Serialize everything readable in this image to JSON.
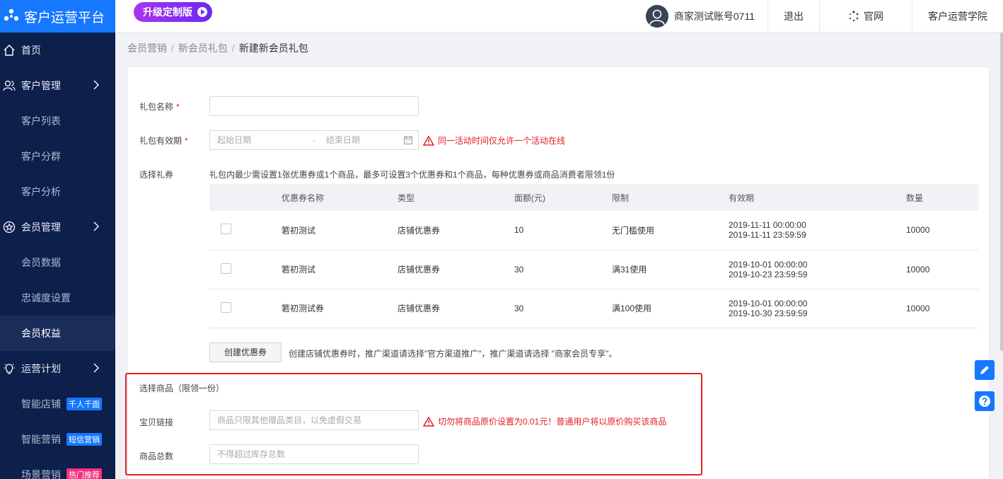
{
  "app": {
    "title": "客户运营平台",
    "upgrade_label": "升级定制版"
  },
  "header": {
    "account": "商家测试账号0711",
    "logout": "退出",
    "official_site": "官网",
    "academy": "客户运营学院"
  },
  "sidebar": {
    "items": [
      {
        "label": "首页",
        "icon": "home-icon"
      },
      {
        "label": "客户管理",
        "icon": "users-icon"
      },
      {
        "label": "客户列表"
      },
      {
        "label": "客户分群"
      },
      {
        "label": "客户分析"
      },
      {
        "label": "会员管理",
        "icon": "star-icon"
      },
      {
        "label": "会员数据"
      },
      {
        "label": "忠诚度设置"
      },
      {
        "label": "会员权益"
      },
      {
        "label": "运营计划",
        "icon": "lightbulb-icon"
      },
      {
        "label": "智能店铺",
        "tag": "千人千面"
      },
      {
        "label": "智能营销",
        "tag": "短信营销"
      },
      {
        "label": "场景营销",
        "tag": "热门推荐"
      }
    ]
  },
  "breadcrumb": [
    "会员营销",
    "新会员礼包",
    "新建新会员礼包"
  ],
  "form": {
    "gift_name_label": "礼包名称",
    "gift_name_required": "*",
    "validity_label": "礼包有效期",
    "validity_required": "*",
    "start_placeholder": "起始日期",
    "date_sep": "-",
    "end_placeholder": "结束日期",
    "validity_warning": "同一活动时间仅允许一个活动在线",
    "coupon_label": "选择礼券",
    "coupon_hint": "礼包内最少需设置1张优惠券或1个商品，最多可设置3个优惠券和1个商品，每种优惠券或商品消费者限领1份",
    "create_coupon_button": "创建优惠券",
    "create_coupon_hint": "创建店铺优惠券时，推广渠道请选择\"官方渠道推广\"，推广渠道请选择 \"商家会员专享\"。",
    "goods_section_label": "选择商品（限领一份）",
    "item_link_label": "宝贝链接",
    "item_link_placeholder": "商品只限其他赠品类目，以免虚假交易",
    "item_link_warning": "切勿将商品原价设置为0.01元！普通用户将以原价购买该商品",
    "goods_total_label": "商品总数",
    "goods_total_placeholder": "不得超过库存总数"
  },
  "coupon_table": {
    "headers": [
      "优惠券名称",
      "类型",
      "面额(元)",
      "限制",
      "有效期",
      "数量"
    ],
    "rows": [
      {
        "name": "箬初测试",
        "type": "店铺优惠券",
        "amount": "10",
        "limit": "无门槛使用",
        "start": "2019-11-11 00:00:00",
        "end": "2019-11-11 23:59:59",
        "qty": "10000"
      },
      {
        "name": "箬初测试",
        "type": "店铺优惠券",
        "amount": "30",
        "limit": "满31使用",
        "start": "2019-10-01 00:00:00",
        "end": "2019-10-23 23:59:59",
        "qty": "10000"
      },
      {
        "name": "箬初测试券",
        "type": "店铺优惠券",
        "amount": "30",
        "limit": "满100使用",
        "start": "2019-10-01 00:00:00",
        "end": "2019-10-30 23:59:59",
        "qty": "10000"
      }
    ]
  },
  "colors": {
    "sidebar_bg": "#0d1f4b",
    "brand_blue": "#1677ff",
    "warning_red": "#e51c23"
  }
}
